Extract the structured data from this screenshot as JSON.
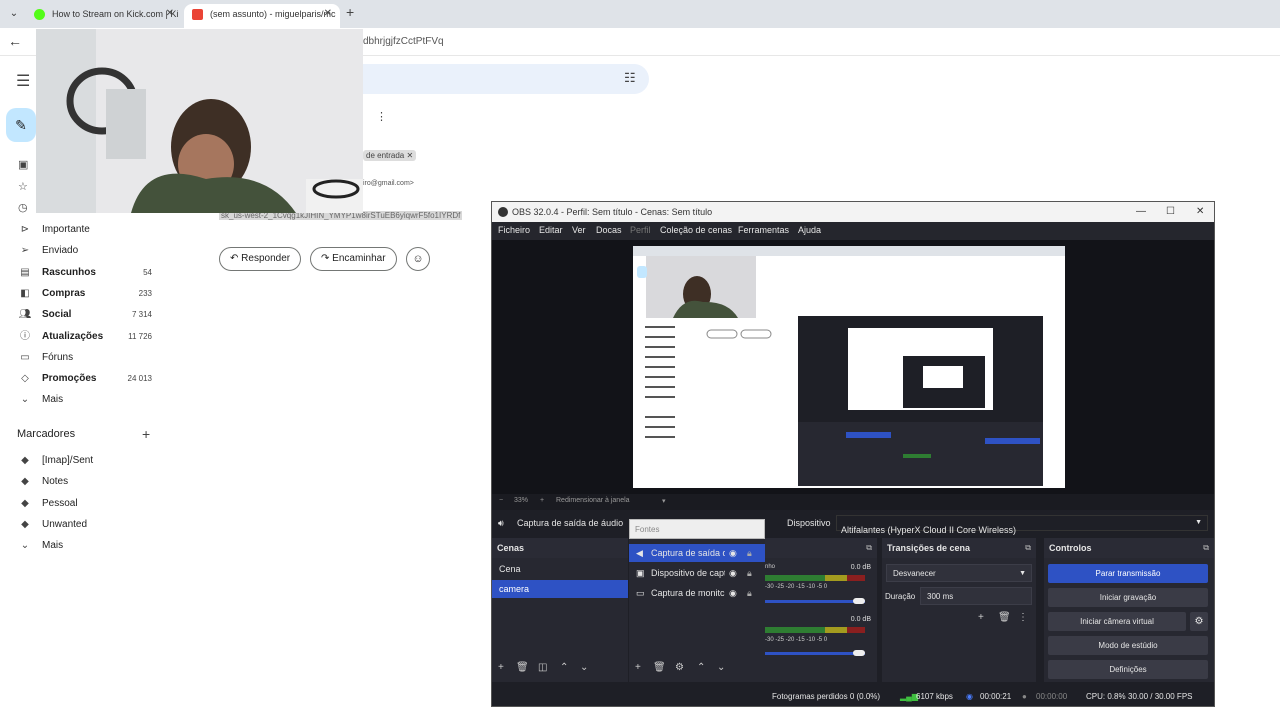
{
  "browser": {
    "tabs": [
      {
        "title": "How to Stream on Kick.com | Ki"
      },
      {
        "title": "(sem assunto) - miguelparis/mc"
      }
    ],
    "url_fragment": "dbhrjgjfzCctPtFVq"
  },
  "gmail": {
    "nav": [
      {
        "label": "Importante",
        "count": "",
        "icon": "label-important-icon"
      },
      {
        "label": "Enviado",
        "count": "",
        "icon": "send-icon"
      },
      {
        "label": "Rascunhos",
        "count": "54",
        "icon": "draft-icon"
      },
      {
        "label": "Compras",
        "count": "233",
        "icon": "shopping-icon"
      },
      {
        "label": "Social",
        "count": "7 314",
        "icon": "people-icon"
      },
      {
        "label": "Atualizações",
        "count": "11 726",
        "icon": "info-icon"
      },
      {
        "label": "Fóruns",
        "count": "",
        "icon": "forum-icon"
      },
      {
        "label": "Promoções",
        "count": "24 013",
        "icon": "tag-icon"
      },
      {
        "label": "Mais",
        "count": "",
        "icon": "chevron-down-icon"
      }
    ],
    "labels_title": "Marcadores",
    "labels": [
      {
        "label": "[Imap]/Sent"
      },
      {
        "label": "Notes"
      },
      {
        "label": "Pessoal"
      },
      {
        "label": "Unwanted"
      },
      {
        "label": "Mais"
      }
    ],
    "inbox_chip": "de entrada",
    "email_fragment": "iro@gmail.com>",
    "key_text": "sk_us-west-2_1Cvqg1kJIHIN_YMYP1w8irSTuEB6yiqwrF5fo1IYRDf",
    "reply_label": "Responder",
    "forward_label": "Encaminhar"
  },
  "obs": {
    "title": "OBS 32.0.4 - Perfil: Sem título - Cenas: Sem título",
    "menu": [
      "Ficheiro",
      "Editar",
      "Ver",
      "Docas",
      "Perfil",
      "Coleção de cenas",
      "Ferramentas",
      "Ajuda"
    ],
    "zoom": "33%",
    "resize_label": "Redimensionar à janela",
    "source_name": "Captura de saída de áudio",
    "device_label": "Dispositivo",
    "device_value": "Altifalantes (HyperX Cloud II Core Wireless)",
    "fontes_label": "Fontes",
    "scenes_title": "Cenas",
    "scenes": [
      {
        "name": "Cena",
        "selected": false
      },
      {
        "name": "camera",
        "selected": true
      }
    ],
    "sources": [
      {
        "name": "Captura de saída d",
        "icon": "speaker-icon",
        "selected": true
      },
      {
        "name": "Dispositivo de capt",
        "icon": "camera-icon",
        "selected": false
      },
      {
        "name": "Captura de monitc",
        "icon": "monitor-icon",
        "selected": false
      }
    ],
    "mixer": [
      {
        "db": "0.0 dB",
        "scale": "-30 -25 -20 -15 -10 -5 0"
      },
      {
        "db": "0.0 dB",
        "scale": "-30 -25 -20 -15 -10 -5 0"
      }
    ],
    "mixer_label_fragment": "nho",
    "transitions_title": "Transições de cena",
    "transition_value": "Desvanecer",
    "duration_label": "Duração",
    "duration_value": "300 ms",
    "controls_title": "Controlos",
    "controls": {
      "stop_stream": "Parar transmissão",
      "start_rec": "Iniciar gravação",
      "start_vcam": "Iniciar câmera virtual",
      "studio_mode": "Modo de estúdio",
      "settings": "Definições"
    },
    "status": {
      "dropped": "Fotogramas perdidos 0 (0.0%)",
      "bitrate": "6107 kbps",
      "stream_time": "00:00:21",
      "rec_time": "00:00:00",
      "cpu": "CPU: 0.8%",
      "fps": "30.00 / 30.00 FPS"
    }
  }
}
